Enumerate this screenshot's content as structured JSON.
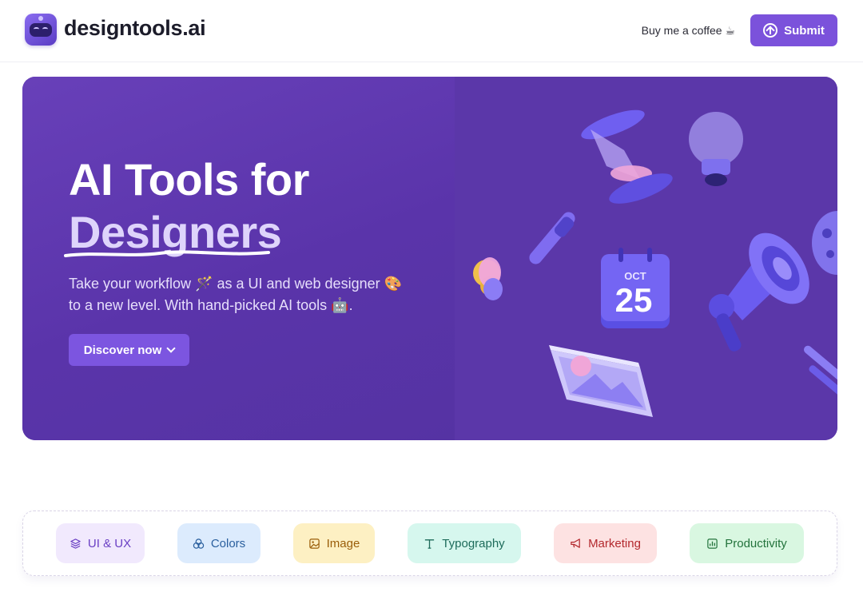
{
  "header": {
    "brand": "designtools.ai",
    "coffee_label": "Buy me a coffee ☕",
    "submit_label": "Submit"
  },
  "hero": {
    "title_line1": "AI Tools for",
    "title_line2": "Designers",
    "desc_line1": "Take your workflow 🪄 as a UI and web designer 🎨",
    "desc_line2": "to a new level. With hand-picked AI tools 🤖.",
    "cta_label": "Discover now",
    "calendar_month": "OCT",
    "calendar_day": "25"
  },
  "categories": [
    {
      "label": "UI & UX",
      "icon": "layers-icon",
      "bg": "#f1e9fd",
      "fg": "#6a3fc4"
    },
    {
      "label": "Colors",
      "icon": "color-circles-icon",
      "bg": "#dcebfd",
      "fg": "#2a5f9e"
    },
    {
      "label": "Image",
      "icon": "image-icon",
      "bg": "#fdf0c3",
      "fg": "#9a5d09"
    },
    {
      "label": "Typography",
      "icon": "type-icon",
      "bg": "#d6f7ee",
      "fg": "#1d6b5a"
    },
    {
      "label": "Marketing",
      "icon": "megaphone-icon",
      "bg": "#fde2e2",
      "fg": "#b3282d"
    },
    {
      "label": "Productivity",
      "icon": "chart-icon",
      "bg": "#d9f7e1",
      "fg": "#23733c"
    }
  ]
}
